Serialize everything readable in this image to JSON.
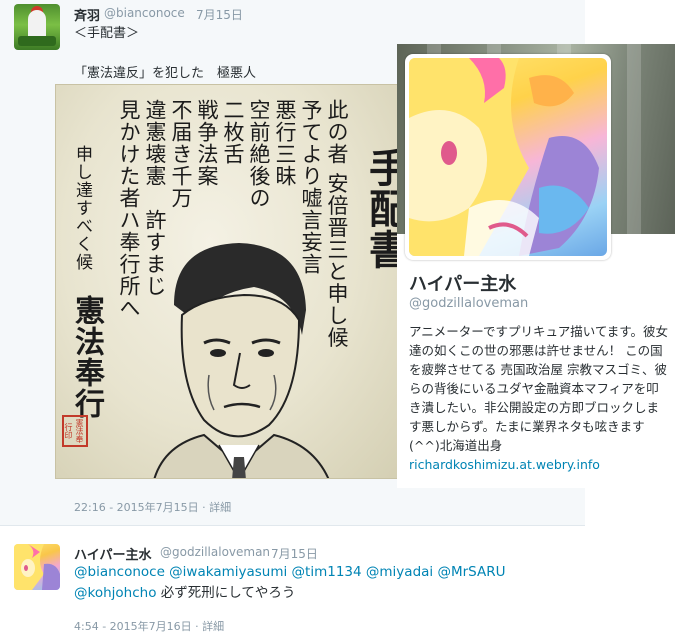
{
  "tweet1": {
    "name": "斉羽",
    "handle": "@bianconoce",
    "date": "7月15日",
    "line1": "＜手配書＞",
    "line2": "「憲法違反」を犯した　極悪人",
    "timestamp": "22:16 - 2015年7月15日",
    "separator": " · ",
    "details": "詳細"
  },
  "poster": {
    "title": "手配書",
    "columns": [
      "此の者 安倍晋三と申し候",
      "予てより嘘言妄言",
      "悪行三昧",
      "空前絶後の",
      "二枚舌",
      "戦争法案",
      "不届き千万",
      "違憲壊憲　許すまじ",
      "見かけた者ハ奉行所へ",
      "申し達すべく候"
    ],
    "signature": "憲法奉行",
    "seal": "憲法奉行印"
  },
  "profile_card": {
    "name": "ハイパー主水",
    "handle": "@godzillaloveman",
    "bio": "アニメーターですプリキュア描いてます。彼女達の如くこの世の邪悪は許せません！ この国を疲弊させてる 売国政治屋 宗教マスゴミ、彼らの背後にいるユダヤ金融資本マフィアを叩き潰したい。非公開設定の方即ブロックします悪しからず。たまに業界ネタも呟きます (^^)北海道出身",
    "link": "richardkoshimizu.at.webry.info"
  },
  "tweet2": {
    "name": "ハイパー主水",
    "handle": "@godzillaloveman",
    "date": "7月15日",
    "mentions": [
      "@bianconoce",
      "@iwakamiyasumi",
      "@tim1134",
      "@miyadai",
      "@MrSARU",
      "@kohjohcho"
    ],
    "text": "必ず死刑にしてやろう",
    "timestamp": "4:54 - 2015年7月16日",
    "separator": " · ",
    "details": "詳細"
  },
  "colors": {
    "link": "#0084b4",
    "muted": "#8899a6",
    "text": "#292f33",
    "tweet_bg": "#f5f8fa",
    "seal_red": "#c23a2a"
  }
}
